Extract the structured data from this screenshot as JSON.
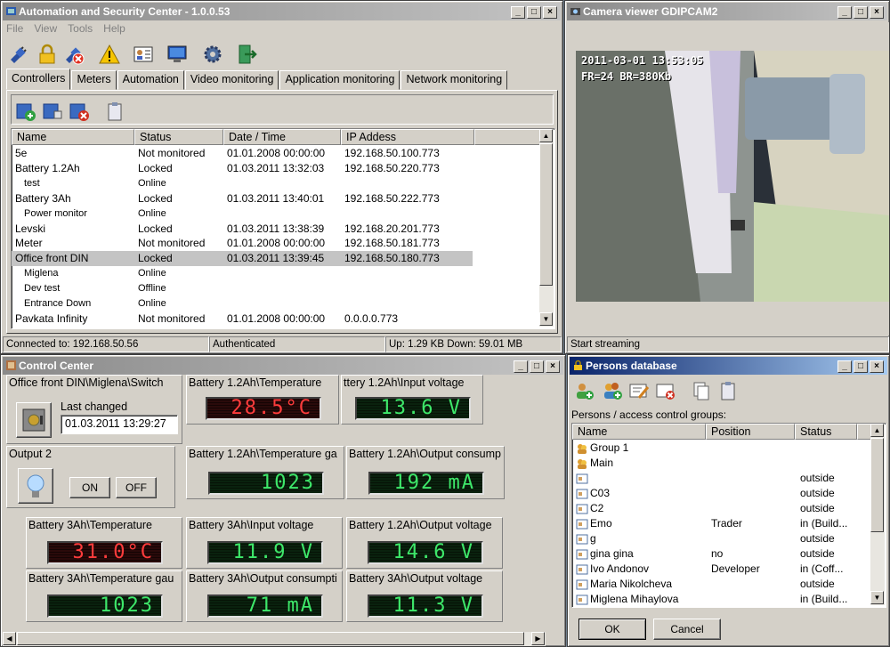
{
  "main_window": {
    "title": "Automation and Security Center - 1.0.0.53",
    "menu": [
      "File",
      "View",
      "Tools",
      "Help"
    ],
    "toolbar_icons": [
      "plug-icon",
      "lock-icon",
      "plug-off-icon",
      "warning-icon",
      "id-card-icon",
      "monitor-icon",
      "gear-icon",
      "exit-icon"
    ],
    "tabs": [
      "Controllers",
      "Meters",
      "Automation",
      "Video monitoring",
      "Application monitoring",
      "Network monitoring"
    ],
    "sub_toolbar_icons": [
      "add-controller-icon",
      "edit-controller-icon",
      "delete-controller-icon",
      "clipboard-icon"
    ],
    "columns": [
      "Name",
      "Status",
      "Date / Time",
      "IP Addess"
    ],
    "rows": [
      {
        "name": "5e",
        "status": "Not monitored",
        "datetime": "01.01.2008 00:00:00",
        "ip": "192.168.50.100.773",
        "sub": false
      },
      {
        "name": "Battery 1.2Ah",
        "status": "Locked",
        "datetime": "01.03.2011 13:32:03",
        "ip": "192.168.50.220.773",
        "sub": false
      },
      {
        "name": "test",
        "status": "Online",
        "datetime": "",
        "ip": "",
        "sub": true
      },
      {
        "name": "Battery 3Ah",
        "status": "Locked",
        "datetime": "01.03.2011 13:40:01",
        "ip": "192.168.50.222.773",
        "sub": false
      },
      {
        "name": "Power monitor",
        "status": "Online",
        "datetime": "",
        "ip": "",
        "sub": true
      },
      {
        "name": "Levski",
        "status": "Locked",
        "datetime": "01.03.2011 13:38:39",
        "ip": "192.168.20.201.773",
        "sub": false
      },
      {
        "name": "Meter",
        "status": "Not monitored",
        "datetime": "01.01.2008 00:00:00",
        "ip": "192.168.50.181.773",
        "sub": false
      },
      {
        "name": "Office front DIN",
        "status": "Locked",
        "datetime": "01.03.2011 13:39:45",
        "ip": "192.168.50.180.773",
        "sub": false,
        "selected": true
      },
      {
        "name": "Miglena",
        "status": "Online",
        "datetime": "",
        "ip": "",
        "sub": true
      },
      {
        "name": "Dev test",
        "status": "Offline",
        "datetime": "",
        "ip": "",
        "sub": true
      },
      {
        "name": "Entrance Down",
        "status": "Online",
        "datetime": "",
        "ip": "",
        "sub": true
      },
      {
        "name": "Pavkata Infinity",
        "status": "Not monitored",
        "datetime": "01.01.2008 00:00:00",
        "ip": "0.0.0.0.773",
        "sub": false
      }
    ],
    "statusbar": [
      "Connected to: 192.168.50.56",
      "Authenticated",
      "Up: 1.29 KB Down: 59.01 MB"
    ]
  },
  "camera_window": {
    "title": "Camera viewer GDIPCAM2",
    "overlay_line1": "2011-03-01 13:53:05",
    "overlay_line2": "FR=24 BR=380Kb",
    "status": "Start streaming"
  },
  "control_center": {
    "title": "Control Center",
    "door_panel": {
      "title": "Office front DIN\\Miglena\\Switch",
      "last_changed_label": "Last changed",
      "last_changed_value": "01.03.2011 13:29:27"
    },
    "output_panel": {
      "title": "Output 2",
      "on_label": "ON",
      "off_label": "OFF"
    },
    "gauges": [
      {
        "title": "Battery 1.2Ah\\Temperature",
        "value": "28.5°C",
        "color": "red"
      },
      {
        "title": "ttery 1.2Ah\\Input voltage",
        "value": "13.6 V",
        "color": "green"
      },
      {
        "title": "Battery 1.2Ah\\Temperature ga",
        "value": "1023",
        "color": "green"
      },
      {
        "title": "Battery 1.2Ah\\Output consump",
        "value": "192 mA",
        "color": "green"
      },
      {
        "title": "Battery 3Ah\\Temperature",
        "value": "31.0°C",
        "color": "red"
      },
      {
        "title": "Battery 3Ah\\Input voltage",
        "value": "11.9 V",
        "color": "green"
      },
      {
        "title": "Battery 1.2Ah\\Output voltage",
        "value": "14.6 V",
        "color": "green"
      },
      {
        "title": "Battery 3Ah\\Temperature gau",
        "value": "1023",
        "color": "green"
      },
      {
        "title": "Battery 3Ah\\Output consumpti",
        "value": "71 mA",
        "color": "green"
      },
      {
        "title": "Battery 3Ah\\Output voltage",
        "value": "11.3 V",
        "color": "green"
      }
    ]
  },
  "persons_window": {
    "title": "Persons database",
    "toolbar_icons": [
      "add-person-icon",
      "add-group-icon",
      "edit-person-icon",
      "delete-person-icon",
      "copy-icon",
      "clipboard-icon"
    ],
    "list_label": "Persons / access control groups:",
    "columns": [
      "Name",
      "Position",
      "Status"
    ],
    "rows": [
      {
        "name": "Group 1",
        "position": "",
        "status": "",
        "group": true
      },
      {
        "name": "Main",
        "position": "",
        "status": "",
        "group": true
      },
      {
        "name": "",
        "position": "",
        "status": "outside",
        "group": false
      },
      {
        "name": "C03",
        "position": "",
        "status": "outside",
        "group": false
      },
      {
        "name": "C2",
        "position": "",
        "status": "outside",
        "group": false
      },
      {
        "name": "Emo",
        "position": "Trader",
        "status": "in (Build...",
        "group": false
      },
      {
        "name": "g",
        "position": "",
        "status": "outside",
        "group": false
      },
      {
        "name": "gina gina",
        "position": "no",
        "status": "outside",
        "group": false
      },
      {
        "name": "Ivo Andonov",
        "position": "Developer",
        "status": "in (Coff...",
        "group": false
      },
      {
        "name": "Maria Nikolcheva",
        "position": "",
        "status": "outside",
        "group": false
      },
      {
        "name": "Miglena Mihaylova",
        "position": "",
        "status": "in (Build...",
        "group": false
      }
    ],
    "ok_label": "OK",
    "cancel_label": "Cancel"
  }
}
